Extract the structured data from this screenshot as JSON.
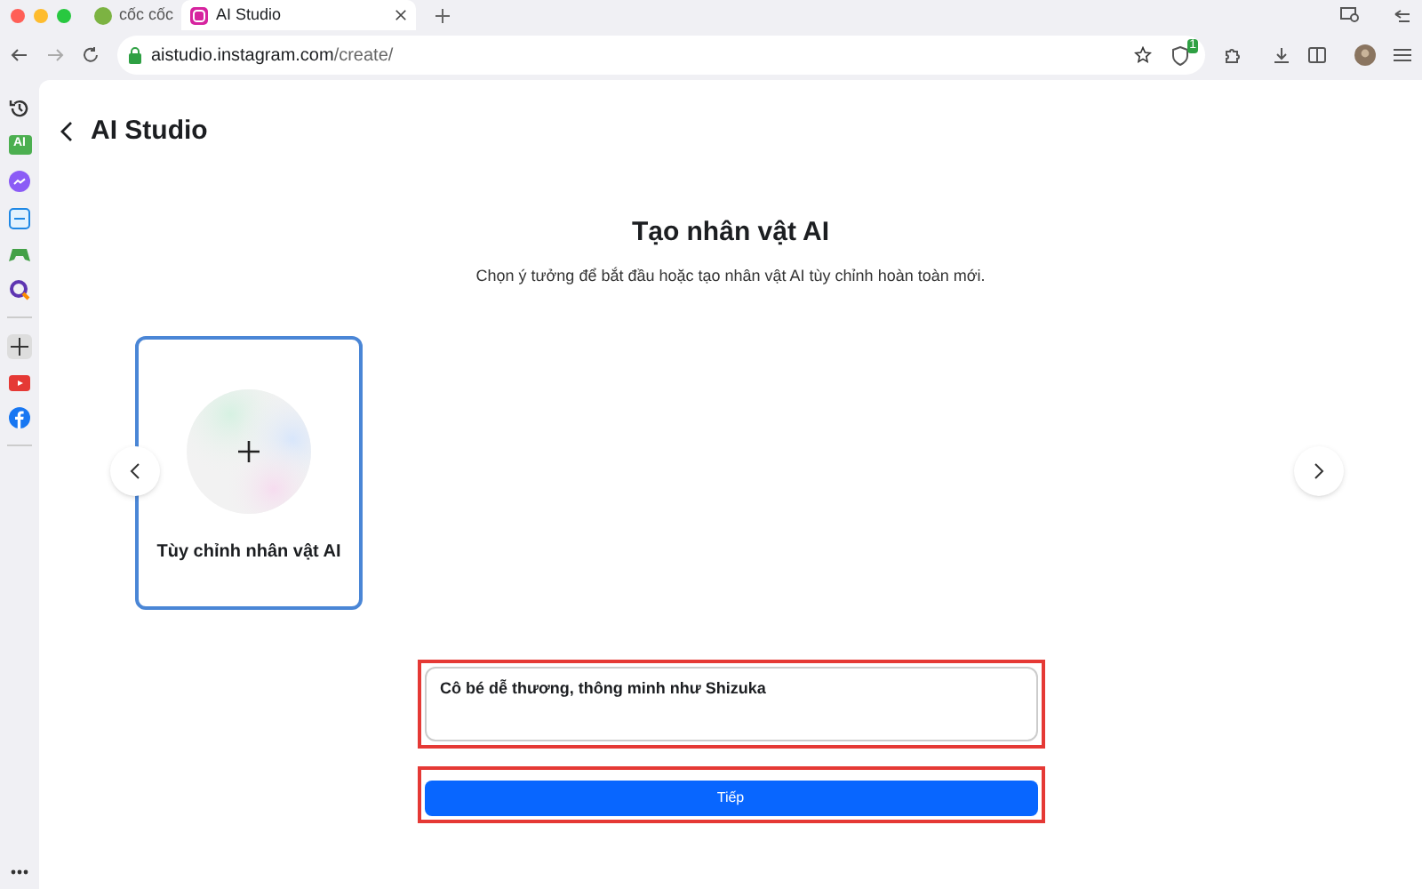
{
  "browser": {
    "tabs": [
      {
        "label": "cốc cốc",
        "selected": false
      },
      {
        "label": "AI Studio",
        "selected": true
      }
    ],
    "url_host": "aistudio.instagram.com",
    "url_path": "/create/",
    "extension_badge": "1"
  },
  "sidebar": {
    "ai_badge": "AI"
  },
  "page": {
    "back_title": "AI Studio",
    "title": "Tạo nhân vật AI",
    "subtitle": "Chọn ý tưởng để bắt đầu hoặc tạo nhân vật AI tùy chỉnh hoàn toàn mới.",
    "cards": [
      {
        "label": "Tùy chỉnh nhân vật AI",
        "selected": true
      }
    ],
    "description": {
      "value": "Cô bé dễ thương, thông minh như Shizuka",
      "highlighted": true
    },
    "next_button": {
      "label": "Tiếp",
      "highlighted": true
    }
  }
}
